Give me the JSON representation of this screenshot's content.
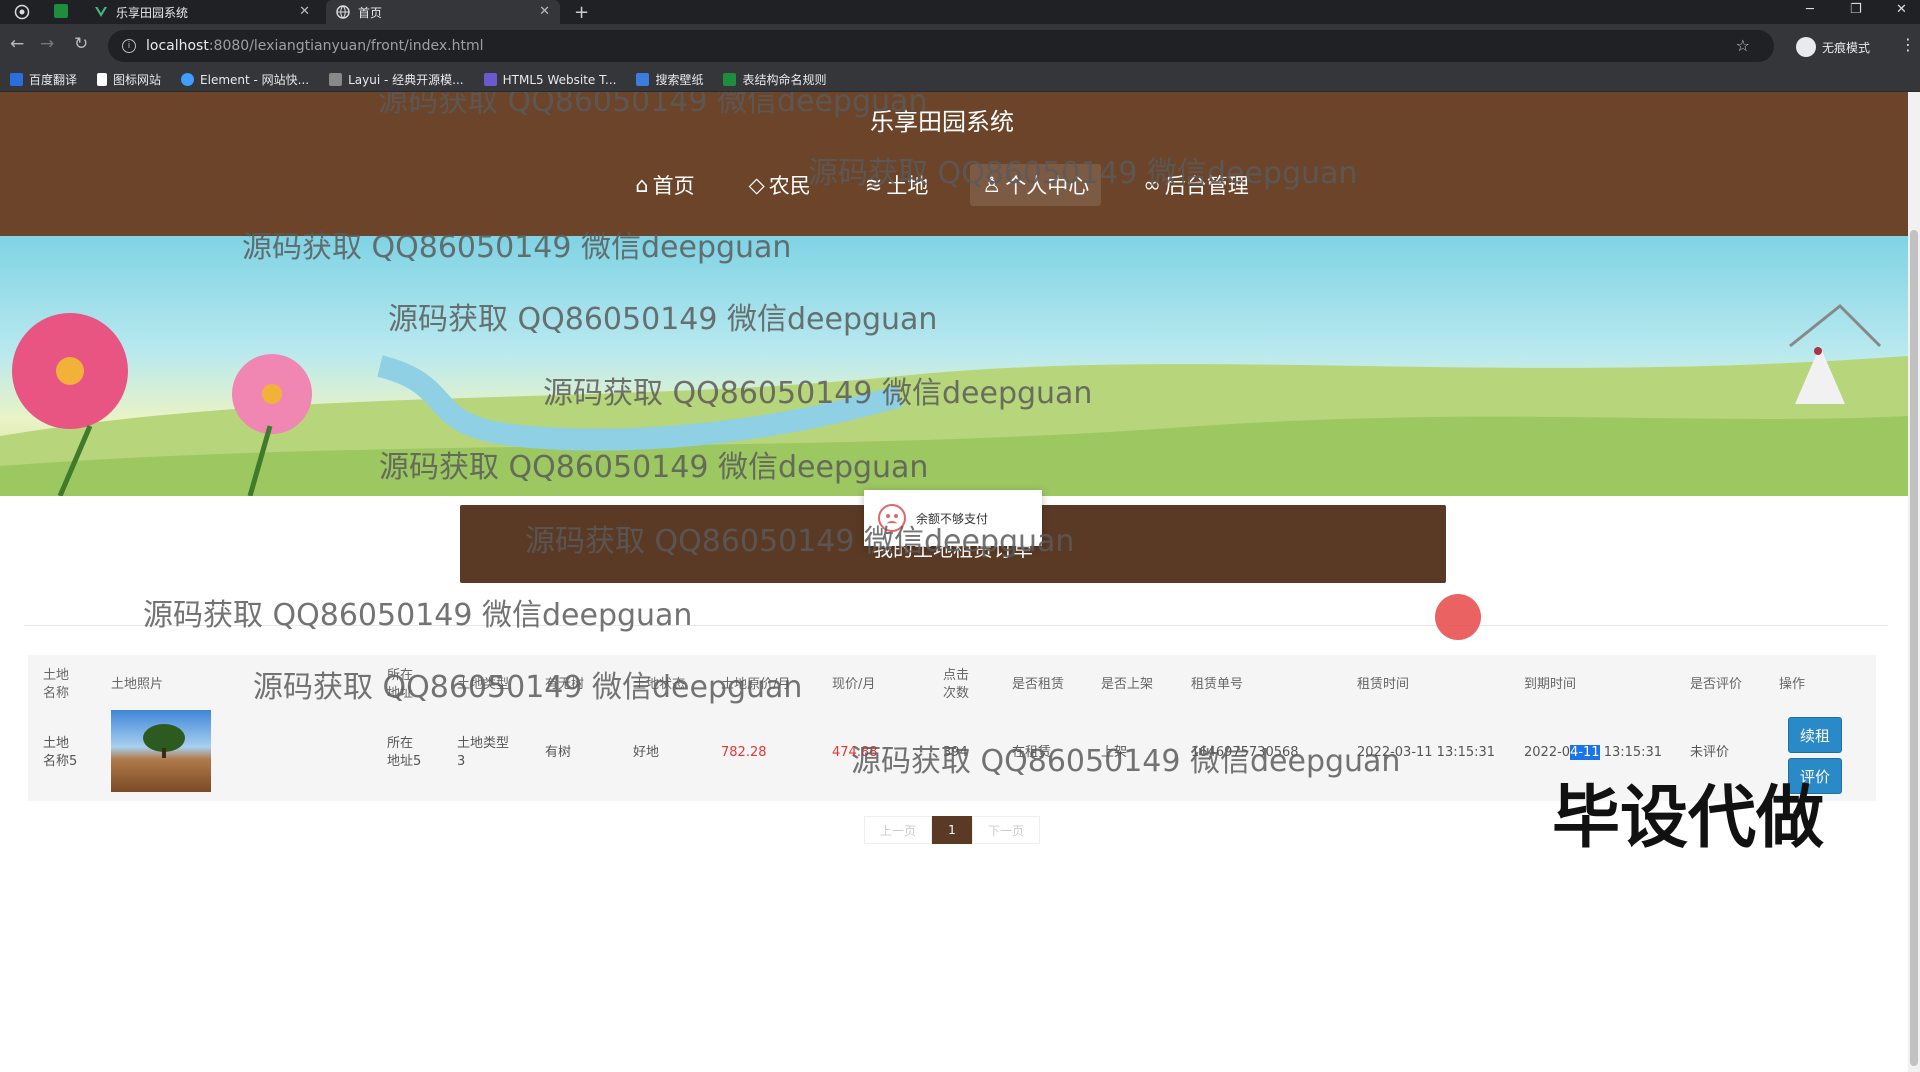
{
  "browser": {
    "tabs": [
      {
        "label": "乐享田园系统"
      },
      {
        "label": "首页"
      }
    ],
    "url_host": "localhost",
    "url_path": ":8080/lexiangtianyuan/front/index.html",
    "incognito_label": "无痕模式",
    "bookmarks": [
      "百度翻译",
      "图标网站",
      "Element - 网站快...",
      "Layui - 经典开源模...",
      "HTML5 Website T...",
      "搜索壁纸",
      "表结构命名规则"
    ]
  },
  "site": {
    "title": "乐享田园系统",
    "nav": [
      {
        "icon": "home-icon",
        "glyph": "⌂",
        "label": "首页"
      },
      {
        "icon": "tag-icon",
        "glyph": "◇",
        "label": "农民"
      },
      {
        "icon": "layers-icon",
        "glyph": "≋",
        "label": "土地"
      },
      {
        "icon": "user-icon",
        "glyph": "♙",
        "label": "个人中心"
      },
      {
        "icon": "link-icon",
        "glyph": "∞",
        "label": "后台管理"
      }
    ]
  },
  "toast": {
    "message": "余额不够支付"
  },
  "order": {
    "title": "我的土地租赁订单"
  },
  "table": {
    "headers": {
      "name": [
        "土地",
        "名称"
      ],
      "photo": "土地照片",
      "address": [
        "所在",
        "地址"
      ],
      "type": "土地类型",
      "tree": "有无树",
      "status": "土地状态",
      "orig_price": "土地原价/月",
      "cur_price": "现价/月",
      "clicks": [
        "点击",
        "次数"
      ],
      "rented": "是否租赁",
      "listed": "是否上架",
      "order_no": "租赁单号",
      "rent_time": "租赁时间",
      "expire_time": "到期时间",
      "reviewed": "是否评价",
      "action": "操作"
    },
    "row": {
      "name": [
        "土地",
        "名称5"
      ],
      "address": [
        "所在",
        "地址5"
      ],
      "type": [
        "土地类型",
        "3"
      ],
      "tree": "有树",
      "status": "好地",
      "orig_price": "782.28",
      "cur_price": "474.88",
      "clicks": "394",
      "rented": "在租赁",
      "listed": "上架",
      "order_no": "1646975730568",
      "rent_time": "2022-03-11 13:15:31",
      "expire_time_a": "2022-0",
      "expire_time_hl": "4-11",
      "expire_time_b": " 13:15:31",
      "reviewed": "未评价",
      "btn_renew": "续租",
      "btn_review": "评价"
    }
  },
  "pager": {
    "prev": "上一页",
    "current": "1",
    "next": "下一页"
  },
  "watermark": "源码获取 QQ86050149 微信deepguan",
  "promo": "毕设代做"
}
